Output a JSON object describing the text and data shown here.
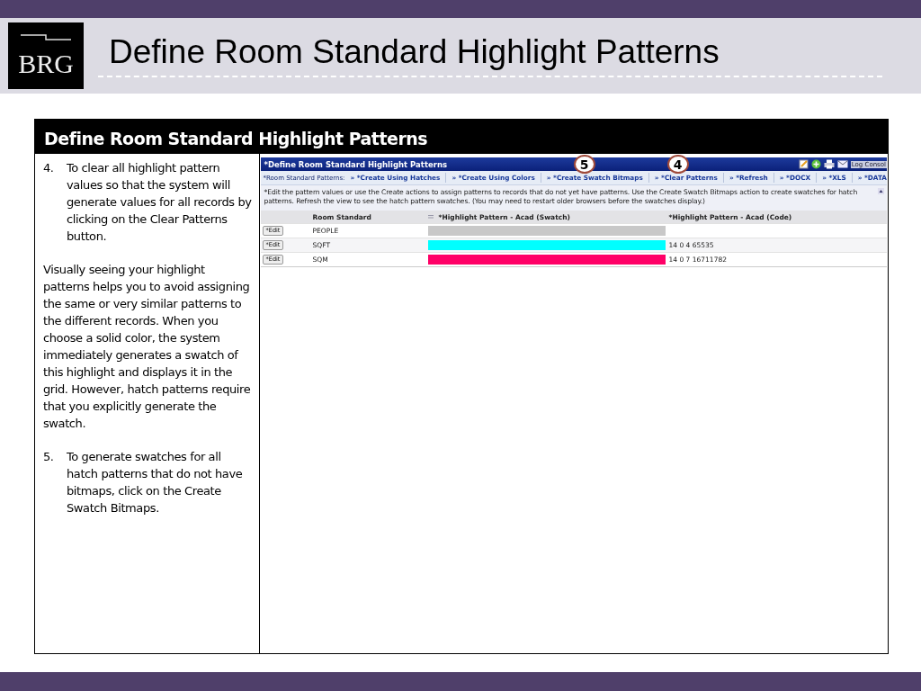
{
  "slide": {
    "logo": "BRG",
    "title": "Define Room Standard Highlight Patterns"
  },
  "box": {
    "heading": "Define Room Standard Highlight Patterns",
    "notes": [
      {
        "kind": "step",
        "number": "4.",
        "text": "To clear all highlight pattern values so that the system will generate values for all records by clicking on the Clear Patterns button."
      },
      {
        "kind": "para",
        "text": "Visually seeing your highlight patterns helps you to avoid assigning the same or very similar patterns to the different records. When you choose a solid color, the system immediately generates a swatch of this highlight and displays it in the grid. However, hatch patterns require that you explicitly generate the swatch."
      },
      {
        "kind": "step",
        "number": "5.",
        "text": "To generate swatches for all hatch patterns that do not have bitmaps, click on the Create Swatch Bitmaps."
      }
    ]
  },
  "app": {
    "title": "*Define Room Standard Highlight Patterns",
    "log": "Log Consol",
    "callouts": [
      {
        "label": "5"
      },
      {
        "label": "4"
      }
    ],
    "toolbar_label": "*Room Standard Patterns:",
    "actions": [
      "» *Create Using Hatches",
      "» *Create Using Colors",
      "» *Create Swatch Bitmaps",
      "» *Clear Patterns",
      "» *Refresh",
      "» *DOCX",
      "» *XLS",
      "» *DATA"
    ],
    "instructions": "*Edit the pattern values or use the Create actions to assign patterns to records that do not yet have patterns. Use the Create Swatch Bitmaps action to create swatches for hatch patterns. Refresh the view to see the hatch pattern swatches. (You may need to restart older browsers before the swatches display.)",
    "columns": [
      "Room Standard",
      "*Highlight Pattern - Acad (Swatch)",
      "*Highlight Pattern - Acad (Code)"
    ],
    "rows": [
      {
        "button": "*Edit",
        "name": "PEOPLE",
        "color": "#c8c8c8",
        "code": ""
      },
      {
        "button": "*Edit",
        "name": "SQFT",
        "color": "#00ffff",
        "code": "14 0 4 65535"
      },
      {
        "button": "*Edit",
        "name": "SQM",
        "color": "#ff0066",
        "code": "14 0 7 16711782"
      }
    ]
  }
}
